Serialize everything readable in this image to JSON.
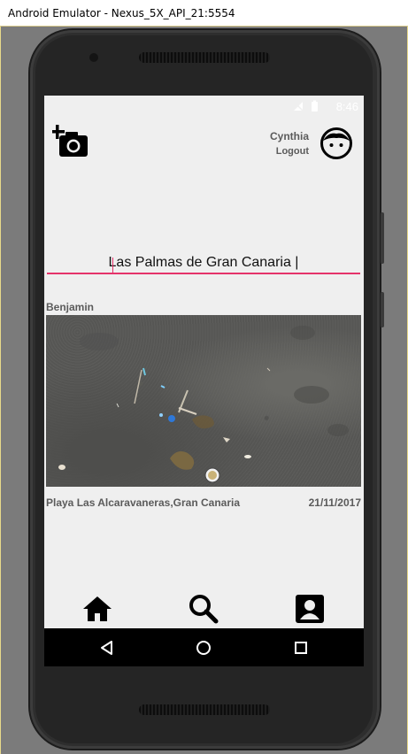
{
  "window": {
    "title": "Android Emulator - Nexus_5X_API_21:5554"
  },
  "status_bar": {
    "time": "8:46"
  },
  "header": {
    "add_photo_icon": "add-photo-camera-icon",
    "user_name": "Cynthia",
    "logout_label": "Logout",
    "avatar_icon": "face-icon"
  },
  "location": {
    "value": "Las Palmas de Gran Canaria |"
  },
  "post": {
    "author": "Benjamin",
    "location": "Playa Las Alcaravaneras,Gran Canaria",
    "date": "21/11/2017"
  },
  "bottom_nav": {
    "items": [
      {
        "icon": "home-icon"
      },
      {
        "icon": "search-icon"
      },
      {
        "icon": "account-box-icon"
      }
    ]
  },
  "system_nav": {
    "items": [
      "back-icon",
      "home-circle-icon",
      "recents-icon"
    ]
  },
  "colors": {
    "accent": "#e5336a",
    "screen_bg": "#efefef",
    "text_muted": "#5b5b5b"
  }
}
